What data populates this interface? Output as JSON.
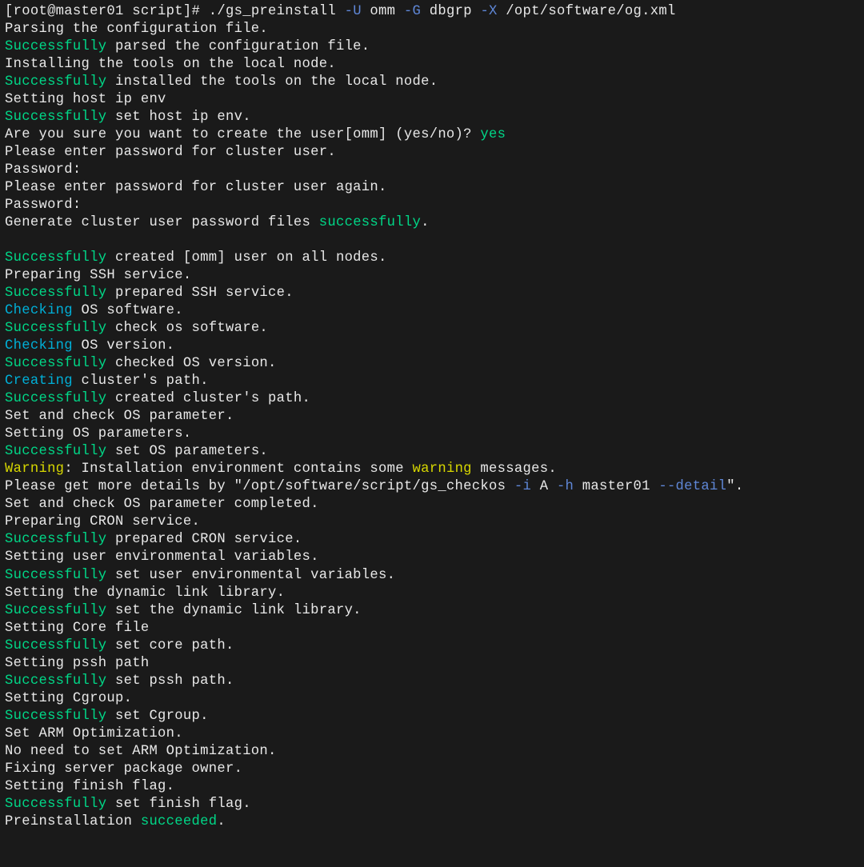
{
  "prompt": {
    "user_host": "[root@master01 script]# ",
    "cmd_start": "./gs_preinstall ",
    "flag_u": "-U",
    "arg_u": " omm ",
    "flag_g": "-G",
    "arg_g": " dbgrp ",
    "flag_x": "-X",
    "arg_x": " /opt/software/og.xml"
  },
  "lines": {
    "l1": "Parsing the configuration file.",
    "l2a": "Successfully",
    "l2b": " parsed the configuration file.",
    "l3": "Installing the tools on the local node.",
    "l4a": "Successfully",
    "l4b": " installed the tools on the local node.",
    "l5": "Setting host ip env",
    "l6a": "Successfully",
    "l6b": " set host ip env.",
    "l7a": "Are you sure you want to create the user[omm] (yes/no)? ",
    "l7b": "yes",
    "l8": "Please enter password for cluster user.",
    "l9": "Password:",
    "l10": "Please enter password for cluster user again.",
    "l11": "Password:",
    "l12a": "Generate cluster user password files ",
    "l12b": "successfully",
    "l12c": ".",
    "l13": "",
    "l14a": "Successfully",
    "l14b": " created [omm] user on all nodes.",
    "l15": "Preparing SSH service.",
    "l16a": "Successfully",
    "l16b": " prepared SSH service.",
    "l17a": "Checking",
    "l17b": " OS software.",
    "l18a": "Successfully",
    "l18b": " check os software.",
    "l19a": "Checking",
    "l19b": " OS version.",
    "l20a": "Successfully",
    "l20b": " checked OS version.",
    "l21a": "Creating",
    "l21b": " cluster's path.",
    "l22a": "Successfully",
    "l22b": " created cluster's path.",
    "l23": "Set and check OS parameter.",
    "l24": "Setting OS parameters.",
    "l25a": "Successfully",
    "l25b": " set OS parameters.",
    "l26a": "Warning",
    "l26b": ": Installation environment contains some ",
    "l26c": "warning",
    "l26d": " messages.",
    "l27a": "Please get more details by \"/opt/software/script/gs_checkos ",
    "l27b": "-i",
    "l27c": " A ",
    "l27d": "-h",
    "l27e": " master01 ",
    "l27f": "--detail",
    "l27g": "\".",
    "l28": "Set and check OS parameter completed.",
    "l29": "Preparing CRON service.",
    "l30a": "Successfully",
    "l30b": " prepared CRON service.",
    "l31": "Setting user environmental variables.",
    "l32a": "Successfully",
    "l32b": " set user environmental variables.",
    "l33": "Setting the dynamic link library.",
    "l34a": "Successfully",
    "l34b": " set the dynamic link library.",
    "l35": "Setting Core file",
    "l36a": "Successfully",
    "l36b": " set core path.",
    "l37": "Setting pssh path",
    "l38a": "Successfully",
    "l38b": " set pssh path.",
    "l39": "Setting Cgroup.",
    "l40a": "Successfully",
    "l40b": " set Cgroup.",
    "l41": "Set ARM Optimization.",
    "l42": "No need to set ARM Optimization.",
    "l43": "Fixing server package owner.",
    "l44": "Setting finish flag.",
    "l45a": "Successfully",
    "l45b": " set finish flag.",
    "l46a": "Preinstallation ",
    "l46b": "succeeded",
    "l46c": "."
  }
}
